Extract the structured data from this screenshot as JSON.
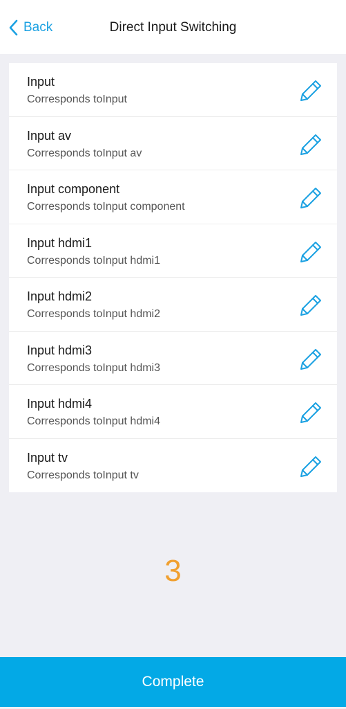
{
  "header": {
    "back_label": "Back",
    "title": "Direct Input Switching",
    "accent_color": "#1ba1e2"
  },
  "inputs": [
    {
      "name": "Input",
      "description": "Corresponds toInput"
    },
    {
      "name": "Input av",
      "description": "Corresponds toInput av"
    },
    {
      "name": "Input component",
      "description": "Corresponds toInput component"
    },
    {
      "name": "Input hdmi1",
      "description": "Corresponds toInput hdmi1"
    },
    {
      "name": "Input hdmi2",
      "description": "Corresponds toInput hdmi2"
    },
    {
      "name": "Input hdmi3",
      "description": "Corresponds toInput hdmi3"
    },
    {
      "name": "Input hdmi4",
      "description": "Corresponds toInput hdmi4"
    },
    {
      "name": "Input tv",
      "description": "Corresponds toInput tv"
    }
  ],
  "icons": {
    "back": "chevron-left-icon",
    "edit": "pencil-icon"
  },
  "countdown": {
    "value": "3",
    "color": "#f0a030"
  },
  "footer": {
    "complete_label": "Complete",
    "button_color": "#03a9e6"
  }
}
